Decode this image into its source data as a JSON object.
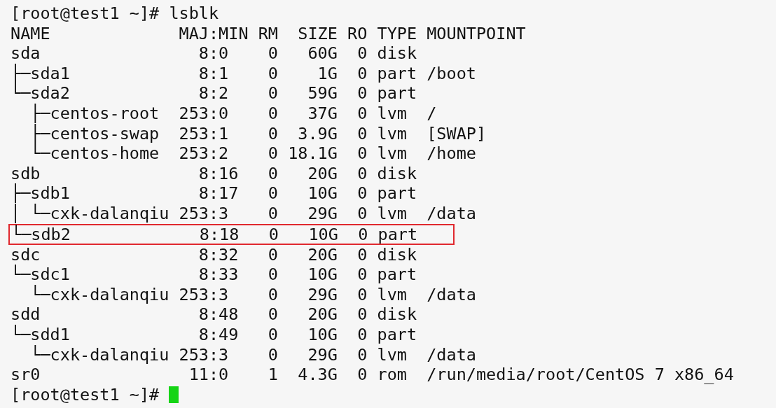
{
  "terminal": {
    "command_prompt": "[root@test1 ~]# ",
    "command": "lsblk",
    "output": [
      {
        "text": "NAME             MAJ:MIN RM  SIZE RO TYPE MOUNTPOINT",
        "highlighted": false
      },
      {
        "text": "sda                8:0    0   60G  0 disk",
        "highlighted": false
      },
      {
        "text": "├─sda1             8:1    0    1G  0 part /boot",
        "highlighted": false
      },
      {
        "text": "└─sda2             8:2    0   59G  0 part",
        "highlighted": false
      },
      {
        "text": "  ├─centos-root  253:0    0   37G  0 lvm  /",
        "highlighted": false
      },
      {
        "text": "  ├─centos-swap  253:1    0  3.9G  0 lvm  [SWAP]",
        "highlighted": false
      },
      {
        "text": "  └─centos-home  253:2    0 18.1G  0 lvm  /home",
        "highlighted": false
      },
      {
        "text": "sdb                8:16   0   20G  0 disk",
        "highlighted": false
      },
      {
        "text": "├─sdb1             8:17   0   10G  0 part",
        "highlighted": false
      },
      {
        "text": "│ └─cxk-dalanqiu 253:3    0   29G  0 lvm  /data",
        "highlighted": false
      },
      {
        "text": "└─sdb2             8:18   0   10G  0 part",
        "highlighted": true
      },
      {
        "text": "sdc                8:32   0   20G  0 disk",
        "highlighted": false
      },
      {
        "text": "└─sdc1             8:33   0   10G  0 part",
        "highlighted": false
      },
      {
        "text": "  └─cxk-dalanqiu 253:3    0   29G  0 lvm  /data",
        "highlighted": false
      },
      {
        "text": "sdd                8:48   0   20G  0 disk",
        "highlighted": false
      },
      {
        "text": "└─sdd1             8:49   0   10G  0 part",
        "highlighted": false
      },
      {
        "text": "  └─cxk-dalanqiu 253:3    0   29G  0 lvm  /data",
        "highlighted": false
      },
      {
        "text": "sr0               11:0    1  4.3G  0 rom  /run/media/root/CentOS 7 x86_64",
        "highlighted": false
      }
    ],
    "final_prompt": "[root@test1 ~]# "
  }
}
